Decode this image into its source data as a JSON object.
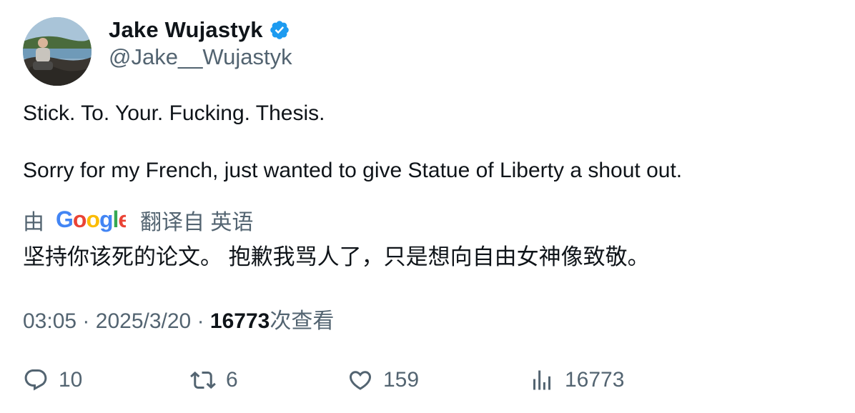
{
  "author": {
    "name": "Jake Wujastyk",
    "handle": "@Jake__Wujastyk",
    "verified": true,
    "avatar_icon": "profile-photo"
  },
  "tweet": {
    "line1": "Stick. To. Your. Fucking. Thesis.",
    "line2": "Sorry for my French, just wanted to give Statue of Liberty a shout out."
  },
  "translation": {
    "prefix": "由",
    "provider": "Google",
    "suffix": "翻译自 英语",
    "text": "坚持你该死的论文。 抱歉我骂人了，只是想向自由女神像致敬。"
  },
  "meta": {
    "time": "03:05",
    "separator": "·",
    "date": "2025/3/20",
    "views": "16773",
    "views_label": "次查看"
  },
  "actions": {
    "replies": "10",
    "retweets": "6",
    "likes": "159",
    "views": "16773"
  },
  "colors": {
    "text": "#0f1419",
    "secondary": "#536471",
    "verified": "#1d9bf0"
  }
}
